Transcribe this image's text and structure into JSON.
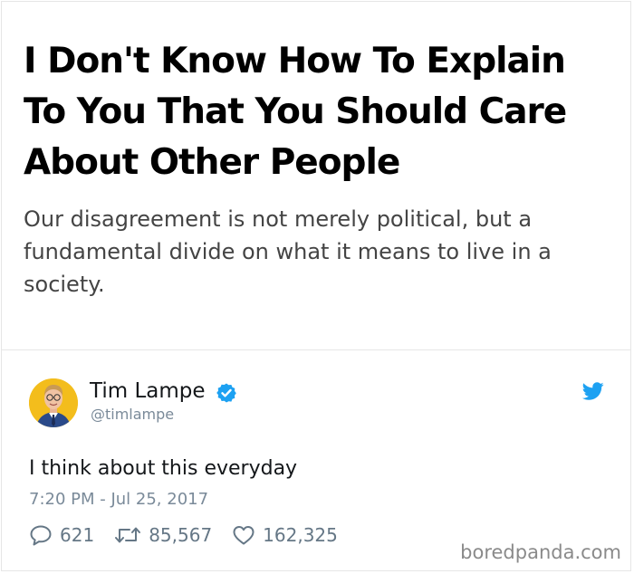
{
  "article": {
    "headline": "I Don't Know How To Explain To You That You Should Care About Other People",
    "subtitle": "Our disagreement is not merely political, but a fundamental divide on what it means to live in a society."
  },
  "tweet": {
    "author_name": "Tim Lampe",
    "handle": "@timlampe",
    "verified": true,
    "text": "I think about this everyday",
    "timestamp": "7:20 PM - Jul 25, 2017",
    "replies": "621",
    "retweets": "85,567",
    "likes": "162,325",
    "icons": {
      "avatar": "avatar",
      "verified": "verified-badge-icon",
      "brand": "twitter-bird-icon",
      "reply": "reply-icon",
      "retweet": "retweet-icon",
      "like": "heart-icon"
    }
  },
  "watermark": "boredpanda.com",
  "colors": {
    "twitter_blue": "#1da1f2",
    "avatar_background": "#f3bd1c",
    "muted_text": "#7a8a99",
    "border": "#e6e6e6"
  }
}
